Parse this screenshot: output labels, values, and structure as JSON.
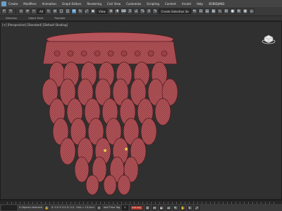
{
  "menubar": {
    "items": [
      "Create",
      "Modifiers",
      "Animation",
      "Graph Editors",
      "Rendering",
      "Civil View",
      "Customize",
      "Scripting",
      "Content",
      "Arnold",
      "Help",
      "XOBIDJAND"
    ]
  },
  "toolbar": {
    "selection_filter": "All",
    "view_select": "View",
    "selection_set": "Create Selection Se"
  },
  "ribbon": {
    "tabs": [
      "Selection",
      "Object Paint",
      "Populate"
    ]
  },
  "viewport": {
    "label": "[+] [Perspective] [Standard] [Default Shading]",
    "model_color": "#b5545a",
    "wire_color": "#4e1b1e"
  },
  "status": {
    "script_field": "",
    "message": "0 Objects Selected",
    "coords": "X: 0.0  Y: 0.0  Z: 0.0",
    "grid": "Grid = 10.0cm",
    "add_time_tag": "Add Time Tag",
    "frame": "0",
    "auto_key": "Auto Key"
  },
  "colors": {
    "accent": "#5a88b0",
    "background": "#303030"
  }
}
